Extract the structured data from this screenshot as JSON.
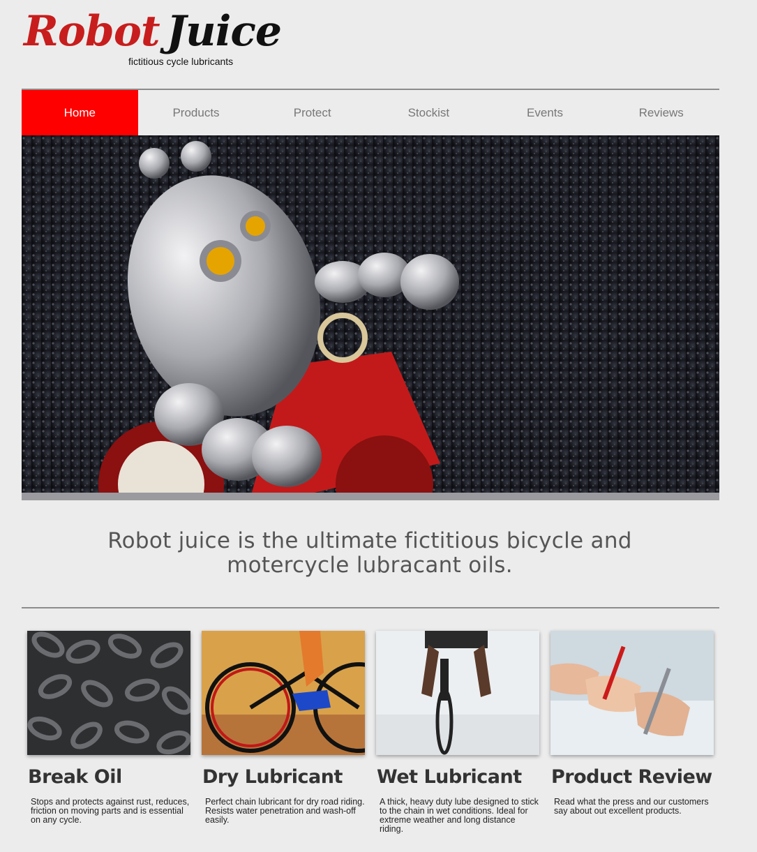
{
  "brand": {
    "name_part1": "Robot",
    "name_part2": "Juice",
    "tagline": "fictitious cycle lubricants"
  },
  "nav": {
    "items": [
      {
        "label": "Home",
        "active": true
      },
      {
        "label": "Products",
        "active": false
      },
      {
        "label": "Protect",
        "active": false
      },
      {
        "label": "Stockist",
        "active": false
      },
      {
        "label": "Events",
        "active": false
      },
      {
        "label": "Reviews",
        "active": false
      }
    ]
  },
  "hero": {
    "image": "toy-robot-on-tricycle-photo"
  },
  "headline": "Robot juice is the ultimate fictitious bicycle and motercycle lubracant oils.",
  "products": [
    {
      "title": "Break Oil",
      "description": "Stops and protects against rust, reduces, friction on moving parts and is essential on any cycle.",
      "image": "bike-chain-photo"
    },
    {
      "title": "Dry Lubricant",
      "description": "Perfect chain lubricant for dry road riding. Resists water penetration and wash-off easily.",
      "image": "road-cyclist-photo"
    },
    {
      "title": "Wet Lubricant",
      "description": "A thick, heavy duty lube designed to stick to the chain in wet conditions. Ideal for extreme weather and long distance riding.",
      "image": "wet-cyclist-photo"
    },
    {
      "title": "Product Review",
      "description": "Read what the press and our customers say about out excellent products.",
      "image": "writing-review-photo"
    }
  ],
  "colors": {
    "accent": "#ff0000",
    "brand_red": "#c81d1d",
    "background": "#ececec"
  }
}
